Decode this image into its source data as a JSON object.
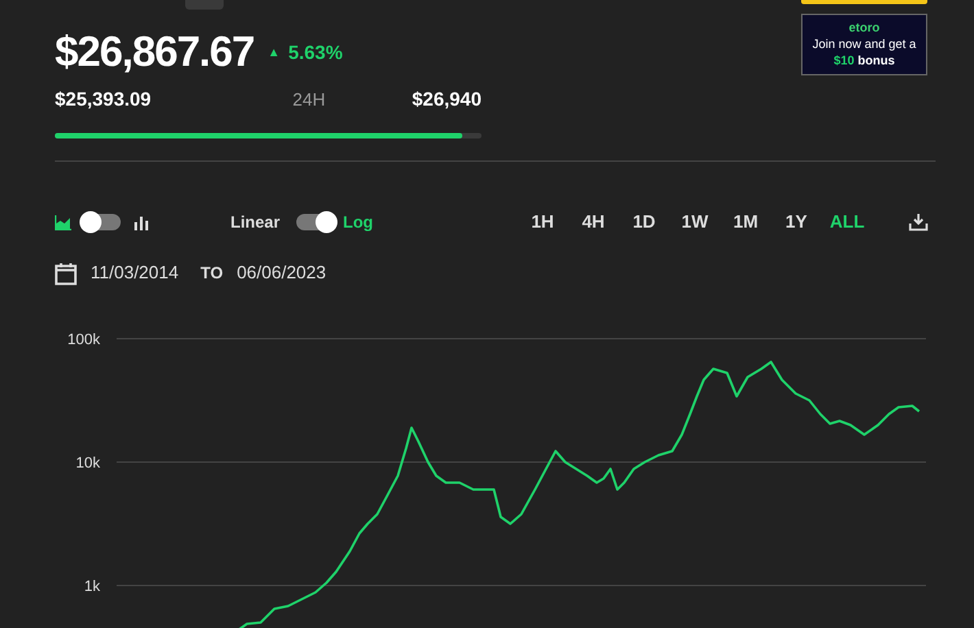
{
  "header": {
    "price": "$26,867.67",
    "arrow": "▲",
    "change": "5.63%",
    "low": "$25,393.09",
    "range_label": "24H",
    "high": "$26,940",
    "level": 0.955
  },
  "ad": {
    "brand": "etoro",
    "line": "Join now and get a",
    "amount": "$10",
    "word": "bonus"
  },
  "chart_types": [
    {
      "kind": "area",
      "selected": true
    },
    {
      "kind": "bar",
      "selected": false
    }
  ],
  "scales": [
    {
      "label": "Linear",
      "selected": false
    },
    {
      "label": "Log",
      "selected": true
    }
  ],
  "ranges": [
    {
      "label": "1H",
      "selected": false
    },
    {
      "label": "4H",
      "selected": false
    },
    {
      "label": "1D",
      "selected": false
    },
    {
      "label": "1W",
      "selected": false
    },
    {
      "label": "1M",
      "selected": false
    },
    {
      "label": "1Y",
      "selected": false
    },
    {
      "label": "ALL",
      "selected": true
    }
  ],
  "date_range": {
    "from": "11/03/2014",
    "separator": "TO",
    "to": "06/06/2023"
  },
  "chart": {
    "y_labels": [
      "100k",
      "10k",
      "1k"
    ]
  }
}
